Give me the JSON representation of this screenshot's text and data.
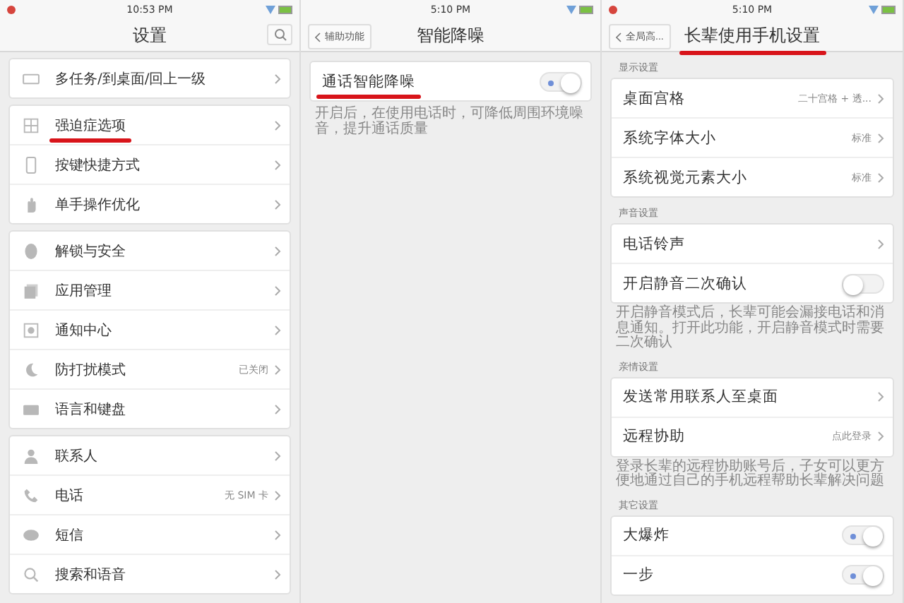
{
  "panels": [
    {
      "status_bar": {
        "time": "10:53 PM",
        "recording": true
      },
      "header": {
        "title": "设置",
        "search": true
      },
      "groups": [
        {
          "rows": [
            {
              "label": "多任务/到桌面/回上一级",
              "value": "",
              "underlined": false
            }
          ]
        },
        {
          "rows": [
            {
              "label": "强迫症选项",
              "underlined": true
            },
            {
              "label": "按键快捷方式",
              "underlined": false
            },
            {
              "label": "单手操作优化",
              "underlined": false
            }
          ]
        },
        {
          "rows": [
            {
              "label": "解锁与安全",
              "underlined": false
            },
            {
              "label": "应用管理",
              "underlined": false
            },
            {
              "label": "通知中心",
              "underlined": false
            },
            {
              "label": "防打扰模式",
              "value": "已关闭",
              "underlined": false
            },
            {
              "label": "语言和键盘",
              "underlined": false
            }
          ]
        },
        {
          "rows": [
            {
              "label": "联系人",
              "underlined": false
            },
            {
              "label": "电话",
              "value": "无 SIM 卡",
              "underlined": false
            },
            {
              "label": "短信",
              "underlined": false
            },
            {
              "label": "搜索和语音",
              "underlined": false
            }
          ]
        }
      ]
    },
    {
      "status_bar": {
        "time": "5:10 PM",
        "recording": false
      },
      "header": {
        "back": "辅助功能",
        "title": "智能降噪"
      },
      "groups": [
        {
          "rows": [
            {
              "label": "通话智能降噪",
              "kind": "toggle",
              "on": true,
              "underlined": true
            }
          ],
          "note": "开启后，在使用电话时，可降低周围环境噪音，提升通话质量"
        }
      ]
    },
    {
      "status_bar": {
        "time": "5:10 PM",
        "recording": true
      },
      "header": {
        "back": "全局高...",
        "title": "长辈使用手机设置",
        "underlined": true
      },
      "groups": [
        {
          "label": "显示设置",
          "rows": [
            {
              "label": "桌面宫格",
              "value": "二十宫格 + 透..."
            },
            {
              "label": "系统字体大小",
              "value": "标准"
            },
            {
              "label": "系统视觉元素大小",
              "value": "标准"
            }
          ]
        },
        {
          "label": "声音设置",
          "rows": [
            {
              "label": "电话铃声"
            },
            {
              "label": "开启静音二次确认",
              "kind": "toggle",
              "on": false
            }
          ],
          "note": "开启静音模式后，长辈可能会漏接电话和消息通知。打开此功能，开启静音模式时需要二次确认"
        },
        {
          "label": "亲情设置",
          "rows": [
            {
              "label": "发送常用联系人至桌面"
            },
            {
              "label": "远程协助",
              "value": "点此登录"
            }
          ],
          "note": "登录长辈的远程协助账号后，子女可以更方便地通过自己的手机远程帮助长辈解决问题"
        },
        {
          "label": "其它设置",
          "rows": [
            {
              "label": "大爆炸",
              "kind": "toggle",
              "on": true
            },
            {
              "label": "一步",
              "kind": "toggle",
              "on": true
            }
          ]
        }
      ]
    }
  ]
}
